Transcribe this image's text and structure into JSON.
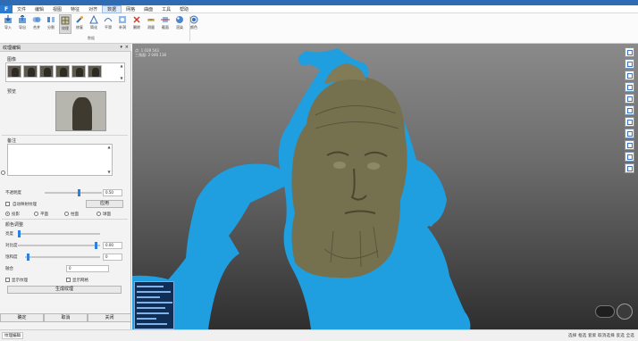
{
  "menubar": {
    "app_button": "F",
    "items": [
      "文件",
      "编辑",
      "视图",
      "特征",
      "对齐",
      "数据",
      "网格",
      "曲面",
      "工具",
      "帮助"
    ],
    "active_index": 5
  },
  "ribbon": {
    "group_caption": "数据",
    "buttons": [
      "导入",
      "导出",
      "合并",
      "分割",
      "纹理",
      "修复",
      "简化",
      "平滑",
      "补洞",
      "删除",
      "测量",
      "截面",
      "渲染",
      "颜色"
    ]
  },
  "left_panel": {
    "title": "纹理编辑",
    "section_images": "图像",
    "section_preview": "预览",
    "section_notes": "备注",
    "thumbs_count": 6,
    "row_opacity_label": "不透明度",
    "row_opacity_value": "0.50",
    "check_auto_label": "自动映射纹理",
    "btn_apply_label": "应用",
    "radio_labels": [
      "投影",
      "平面",
      "柱面",
      "球面"
    ],
    "section_adjust": "颜色调整",
    "row_brightness_label": "亮度",
    "row_contrast_label": "对比度",
    "row_contrast_value": "0.00",
    "row_saturation_label": "饱和度",
    "row_saturation_value": "0",
    "row_blend_label": "融合",
    "row_blend_value": "0",
    "check_a_label": "显示纹理",
    "check_b_label": "显示网格",
    "btn_generate_label": "生成纹理",
    "bottom_tabs": [
      "确定",
      "取消",
      "关闭"
    ]
  },
  "viewport": {
    "info_lines": [
      "点: 1 028 543",
      "三角面: 2 046 118"
    ],
    "mesh_color": "#1f9ee0",
    "texture_color": "#75714f"
  },
  "statusbar": {
    "left": "纹理编辑",
    "right": "选择  框选  套索  取消选择  反选  全选"
  }
}
